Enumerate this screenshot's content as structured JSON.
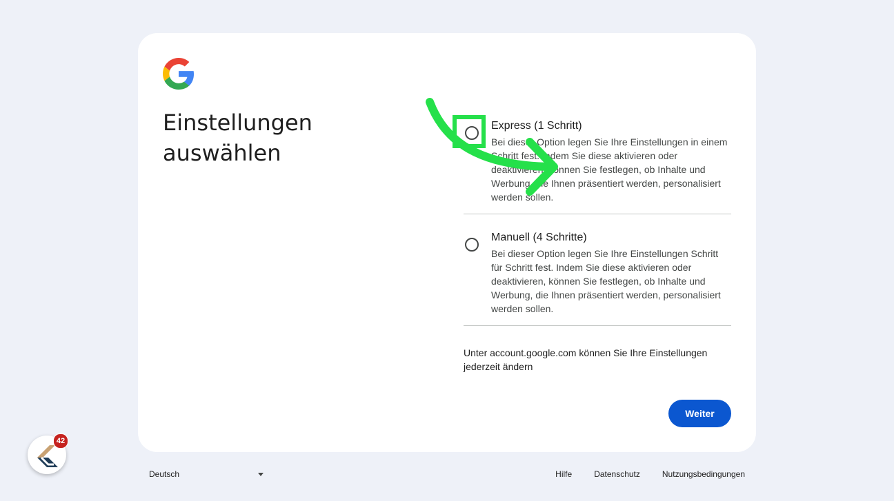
{
  "header": {
    "logo_icon": "google-g-logo-icon",
    "title_line1": "Einstellungen",
    "title_line2": "auswählen"
  },
  "options": [
    {
      "title": "Express (1 Schritt)",
      "description": "Bei dieser Option legen Sie Ihre Einstellungen in einem Schritt fest. Indem Sie diese aktivieren oder deaktivieren, können Sie festlegen, ob Inhalte und Werbung, die Ihnen präsentiert werden, personalisiert werden sollen.",
      "selected": false
    },
    {
      "title": "Manuell (4 Schritte)",
      "description": "Bei dieser Option legen Sie Ihre Einstellungen Schritt für Schritt fest. Indem Sie diese aktivieren oder deaktivieren, können Sie festlegen, ob Inhalte und Werbung, die Ihnen präsentiert werden, personalisiert werden sollen.",
      "selected": false
    }
  ],
  "info_text": "Unter account.google.com können Sie Ihre Einstellungen jederzeit ändern",
  "next_button_label": "Weiter",
  "footer": {
    "language": "Deutsch",
    "links": [
      "Hilfe",
      "Datenschutz",
      "Nutzungsbedingungen"
    ]
  },
  "app_badge": {
    "icon": "app-logo-icon",
    "count": "42"
  },
  "colors": {
    "background": "#eef1f8",
    "primary_button": "#0b57d0",
    "annotation_green": "#25e04a",
    "badge_red": "#c5221f"
  }
}
